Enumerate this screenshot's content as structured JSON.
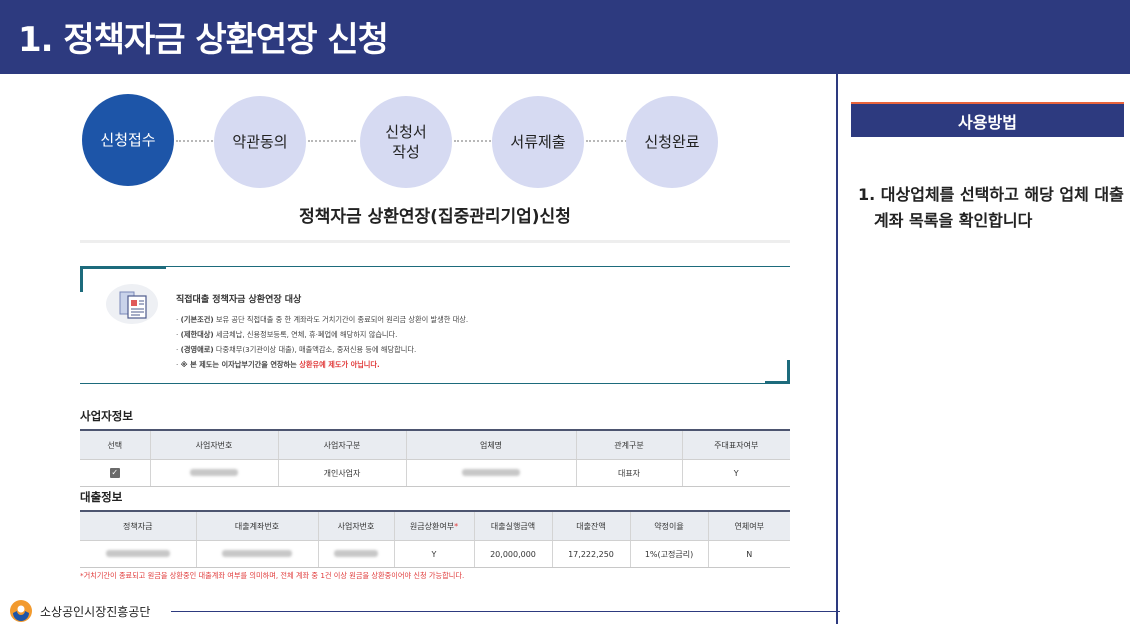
{
  "header": {
    "title": "1. 정책자금 상환연장 신청"
  },
  "steps": [
    {
      "label": "신청접수",
      "active": true
    },
    {
      "label": "약관동의",
      "active": false
    },
    {
      "label": "신청서\n작성",
      "active": false
    },
    {
      "label": "서류제출",
      "active": false
    },
    {
      "label": "신청완료",
      "active": false
    }
  ],
  "main": {
    "title": "정책자금 상환연장(집중관리기업)신청"
  },
  "notice": {
    "heading": "직접대출 정책자금 상환연장 대상",
    "items": [
      {
        "prefix": "(기본조건)",
        "text": " 보유 공단 직접대출 중 한 계좌라도 거치기간이 종료되어 원리금 상환이 발생한 대상."
      },
      {
        "prefix": "(제한대상)",
        "text": " 세금체납, 신용정보등록, 연체, 휴·폐업에 해당하지 않습니다."
      },
      {
        "prefix": "(경영애로)",
        "text": " 다중채무(3기관이상 대출), 매출액감소, 중저신용 등에 해당합니다."
      }
    ],
    "warning_prefix": "※ 본 제도는 이자납부기간을 연장하는 ",
    "warning_red": "상환유예 제도가 아닙니다."
  },
  "business_info": {
    "label": "사업자정보",
    "headers": [
      "선택",
      "사업자번호",
      "사업자구분",
      "업체명",
      "관계구분",
      "주대표자여부"
    ],
    "row": {
      "checkbox_glyph": "✓",
      "type": "개인사업자",
      "relation": "대표자",
      "primary": "Y"
    }
  },
  "loan_info": {
    "label": "대출정보",
    "headers": [
      "정책자금",
      "대출계좌번호",
      "사업자번호",
      "원금상환여부",
      "대출실행금액",
      "대출잔액",
      "약정이율",
      "연체여부"
    ],
    "required_mark": "*",
    "row": {
      "repaid": "Y",
      "executed_amount": "20,000,000",
      "balance": "17,222,250",
      "rate": "1%(고정금리)",
      "overdue": "N"
    }
  },
  "footnote": "*거치기간이 종료되고 원금을 상환중인 대출계좌 여부를 의미하며, 전체 계좌 중 1건 이상 원금을 상환중이어야 신청 가능합니다.",
  "footer": {
    "org_name": "소상공인시장진흥공단"
  },
  "side": {
    "header": "사용방법",
    "instruction": "1. 대상업체를 선택하고 해당 업체 대출계좌 목록을 확인합니다"
  },
  "colors": {
    "brand": "#2d3a7f",
    "step_active": "#1d55a8",
    "step_inactive": "#d6daf2",
    "accent_teal": "#1d6b7c",
    "alert": "#e03a3a"
  }
}
